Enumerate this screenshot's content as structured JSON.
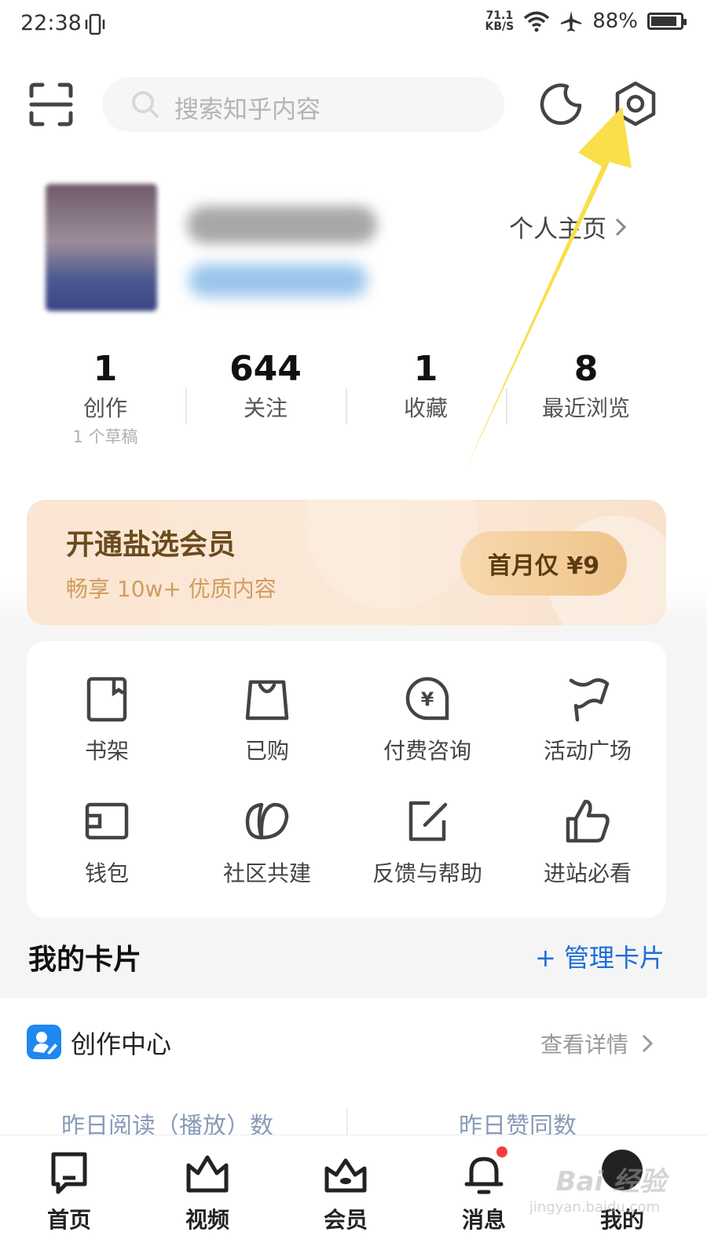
{
  "status_bar": {
    "time": "22:38",
    "net_speed_value": "71.1",
    "net_speed_unit": "KB/S",
    "battery": "88%",
    "battery_level": 0.88
  },
  "header": {
    "search_placeholder": "搜索知乎内容"
  },
  "profile": {
    "homepage_link": "个人主页"
  },
  "stats": [
    {
      "value": "1",
      "label": "创作",
      "sub": "1 个草稿"
    },
    {
      "value": "644",
      "label": "关注",
      "sub": ""
    },
    {
      "value": "1",
      "label": "收藏",
      "sub": ""
    },
    {
      "value": "8",
      "label": "最近浏览",
      "sub": ""
    }
  ],
  "vip": {
    "title": "开通盐选会员",
    "subtitle": "畅享 10w+ 优质内容",
    "button": "首月仅 ¥9"
  },
  "tools": [
    {
      "label": "书架",
      "icon": "bookshelf-icon"
    },
    {
      "label": "已购",
      "icon": "shopping-bag-icon"
    },
    {
      "label": "付费咨询",
      "icon": "paid-consult-icon"
    },
    {
      "label": "活动广场",
      "icon": "flag-icon"
    },
    {
      "label": "钱包",
      "icon": "wallet-icon"
    },
    {
      "label": "社区共建",
      "icon": "community-icon"
    },
    {
      "label": "反馈与帮助",
      "icon": "feedback-icon"
    },
    {
      "label": "进站必看",
      "icon": "thumbs-up-icon"
    }
  ],
  "cards": {
    "title": "我的卡片",
    "manage": "+ 管理卡片"
  },
  "creation_center": {
    "title": "创作中心",
    "details": "查看详情",
    "metrics": [
      "昨日阅读（播放）数",
      "昨日赞同数"
    ]
  },
  "bottom_nav": [
    {
      "label": "首页",
      "icon": "home-icon"
    },
    {
      "label": "视频",
      "icon": "video-icon"
    },
    {
      "label": "会员",
      "icon": "vip-crown-icon"
    },
    {
      "label": "消息",
      "icon": "bell-icon"
    },
    {
      "label": "我的",
      "icon": "me-avatar-icon"
    }
  ],
  "watermark": {
    "text": "Bai 经验",
    "sub": "jingyan.baidu.com"
  },
  "colors": {
    "accent_blue": "#1e6fd9",
    "arrow_yellow": "#f9df4a",
    "vip_gold": "#6b4a1e",
    "notification_red": "#f1403c"
  }
}
